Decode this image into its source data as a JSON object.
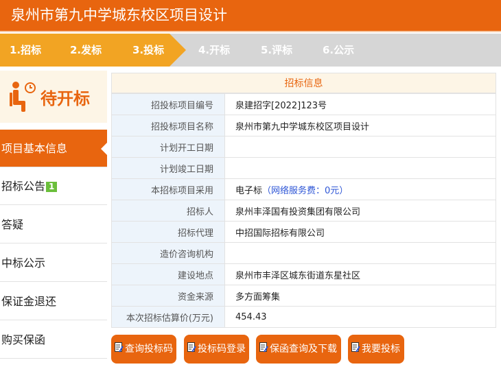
{
  "header": {
    "title": "泉州市第九中学城东校区项目设计"
  },
  "steps": [
    {
      "label": "1.招标",
      "active": true
    },
    {
      "label": "2.发标",
      "active": true
    },
    {
      "label": "3.投标",
      "active": true,
      "current": true
    },
    {
      "label": "4.开标",
      "active": false
    },
    {
      "label": "5.评标",
      "active": false
    },
    {
      "label": "6.公示",
      "active": false
    }
  ],
  "sidebar": {
    "status_icon": "waiting-person-clock-icon",
    "status": "待开标",
    "items": [
      {
        "label": "项目基本信息",
        "active": true
      },
      {
        "label": "招标公告",
        "badge": "1"
      },
      {
        "label": "答疑"
      },
      {
        "label": "中标公示"
      },
      {
        "label": "保证金退还"
      },
      {
        "label": "购买保函"
      }
    ]
  },
  "info": {
    "title": "招标信息",
    "rows": [
      {
        "label": "招投标项目编号",
        "value": "泉建招字[2022]123号"
      },
      {
        "label": "招投标项目名称",
        "value": "泉州市第九中学城东校区项目设计"
      },
      {
        "label": "计划开工日期",
        "value": ""
      },
      {
        "label": "计划竣工日期",
        "value": ""
      },
      {
        "label": "本招标项目采用",
        "value": "电子标",
        "extra": "（网络服务费：0元）"
      },
      {
        "label": "招标人",
        "value": "泉州丰泽国有投资集团有限公司"
      },
      {
        "label": "招标代理",
        "value": "中招国际招标有限公司"
      },
      {
        "label": "造价咨询机构",
        "value": ""
      },
      {
        "label": "建设地点",
        "value": "泉州市丰泽区城东街道东星社区"
      },
      {
        "label": "资金来源",
        "value": "多方面筹集"
      },
      {
        "label": "本次招标估算价(万元)",
        "value": "454.43"
      }
    ]
  },
  "actions": [
    {
      "label": "查询投标码",
      "icon": "edit-document-icon"
    },
    {
      "label": "投标码登录",
      "icon": "edit-document-icon"
    },
    {
      "label": "保函查询及下载",
      "icon": "edit-document-icon"
    },
    {
      "label": "我要投标",
      "icon": "edit-document-icon"
    }
  ],
  "colors": {
    "brand": "#e8650f",
    "progress": "#f2a423",
    "label_bg": "#edf4fb",
    "badge": "#6bbf3b",
    "link": "#2d55d6"
  }
}
